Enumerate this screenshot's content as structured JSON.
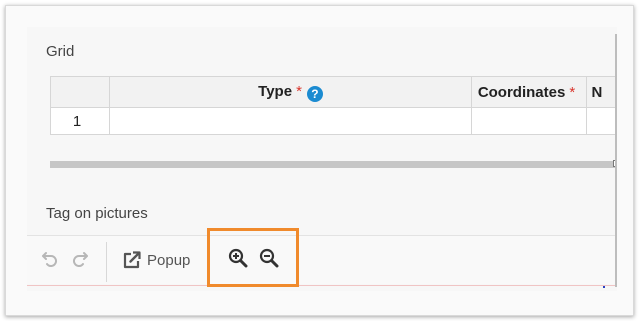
{
  "grid": {
    "label": "Grid",
    "columns": [
      {
        "label": "",
        "key": "rownum"
      },
      {
        "label": "Type",
        "required": "*",
        "help": "?"
      },
      {
        "label": "Coordinates",
        "required": "*"
      },
      {
        "label": "N"
      }
    ],
    "rows": [
      {
        "rownum": "1",
        "type": "",
        "coordinates": "",
        "next": ""
      }
    ]
  },
  "tag_section": {
    "label": "Tag on pictures"
  },
  "toolbar": {
    "undo_icon": "undo-icon",
    "redo_icon": "redo-icon",
    "popup_icon": "external-link-icon",
    "popup_label": "Popup",
    "zoom_in_icon": "zoom-in-icon",
    "zoom_out_icon": "zoom-out-icon"
  },
  "colors": {
    "highlight": "#f08a2c",
    "help_icon": "#1b8bd1",
    "required": "#d9342b"
  }
}
